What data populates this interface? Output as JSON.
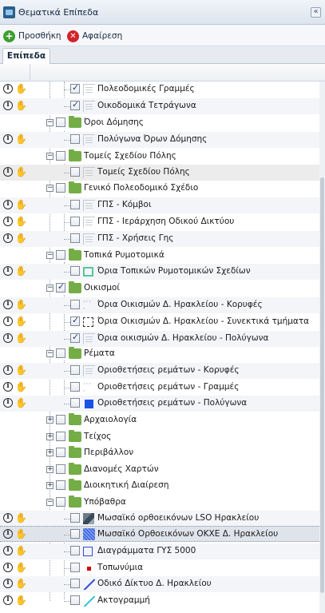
{
  "window": {
    "title": "Θεματικά Επίπεδα"
  },
  "toolbar": {
    "add_label": "Προσθήκη",
    "remove_label": "Αφαίρεση"
  },
  "tabs": [
    {
      "label": "Επίπεδα"
    }
  ],
  "layers": {
    "r0": "Πολεοδομικές Γραμμές",
    "r1": "Οικοδομικά Τετράγωνα",
    "r2": "Όροι Δόμησης",
    "r3": "Πολύγωνα Όρων Δόμησης",
    "r4": "Τομείς Σχεδίου Πόλης",
    "r5": "Τομείς Σχεδίου Πόλης",
    "r6": "Γενικό Πολεοδομικό Σχέδιο",
    "r7": "ΓΠΣ - Κόμβοι",
    "r8": "ΓΠΣ - Ιεράρχηση Οδικού Δικτύου",
    "r9": "ΓΠΣ - Χρήσεις Γης",
    "r10": "Τοπικά Ρυμοτομικά",
    "r11": "Όρια Τοπικών Ρυμοτομικών Σχεδίων",
    "r12": "Οικισμοί",
    "r13": "Όρια Οικισμών Δ. Ηρακλείου - Κορυφές",
    "r14": "Όρια Οικισμών Δ. Ηρακλείου - Συνεκτικά τμήματα",
    "r15": "Όρια οικισμών Δ. Ηρακλείου - Πολύγωνα",
    "r16": "Ρέματα",
    "r17": "Οριοθετήσεις ρεμάτων - Κορυφές",
    "r18": "Οριοθετήσεις ρεμάτων - Γραμμές",
    "r19": "Οριοθετήσεις ρεμάτων - Πολύγωνα",
    "r20": "Αρχαιολογία",
    "r21": "Τείχος",
    "r22": "Περιβάλλον",
    "r23": "Διανομές Χαρτών",
    "r24": "Διοικητική Διαίρεση",
    "r25": "Υπόβαθρα",
    "r26": "Μωσαϊκό ορθοεικόνων LSO Ηρακλείου",
    "r27": "Μωσαϊκό Ορθοεικόνων ΟΚΧΕ Δ. Ηρακλείου",
    "r28": "Διαγράμματα ΓΥΣ 5000",
    "r29": "Τοπωνύμια",
    "r30": "Οδικό Δίκτυο Δ. Ηρακλείου",
    "r31": "Ακτογραμμή"
  },
  "symbols": {
    "r0": "layer-icon",
    "r1": "layer-icon",
    "r3": "polygon-outline-icon",
    "r5": "layer-icon",
    "r7": "layer-icon",
    "r8": "layer-icon",
    "r9": "layer-icon",
    "r11": "green-square-icon",
    "r13": "points-icon",
    "r14": "dashed-square-icon",
    "r15": "layer-icon",
    "r17": "layer-icon",
    "r18": "points-icon",
    "r19": "blue-square-icon",
    "r26": "orthophoto-icon",
    "r27": "hatched-square-icon",
    "r28": "blue-outline-square-icon",
    "r29": "red-point-icon",
    "r30": "blue-line-icon",
    "r31": "cyan-line-icon"
  },
  "colors": {
    "folder": "#74ad46",
    "accent_blue": "#1a52e6",
    "place_names_red": "#d40000",
    "coastline_cyan": "#34c4d2",
    "settlements_green": "#59c59a"
  }
}
